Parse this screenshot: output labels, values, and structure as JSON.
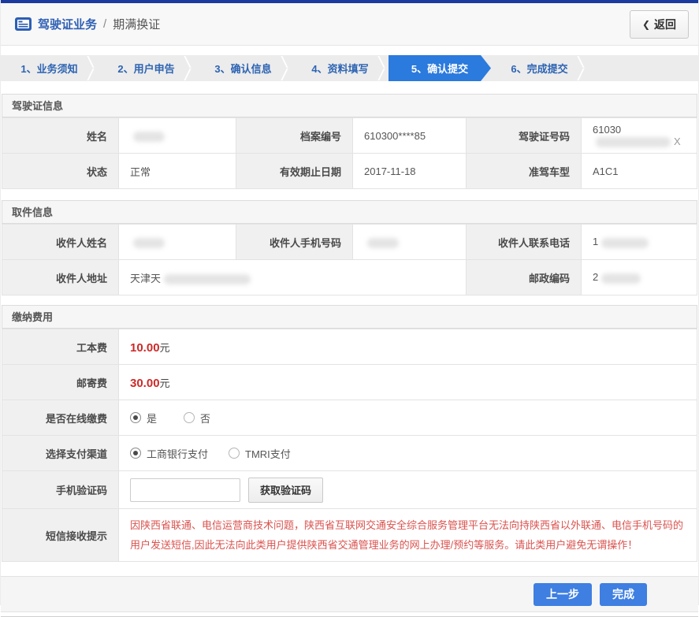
{
  "header": {
    "title_primary": "驾驶证业务",
    "separator": "/",
    "title_secondary": "期满换证",
    "back_chevron": "❮",
    "back_label": "返回"
  },
  "steps": [
    {
      "label": "1、业务须知",
      "active": false
    },
    {
      "label": "2、用户申告",
      "active": false
    },
    {
      "label": "3、确认信息",
      "active": false
    },
    {
      "label": "4、资料填写",
      "active": false
    },
    {
      "label": "5、确认提交",
      "active": true
    },
    {
      "label": "6、完成提交",
      "active": false
    }
  ],
  "license": {
    "title": "驾驶证信息",
    "name_label": "姓名",
    "name_value": "",
    "file_no_label": "档案编号",
    "file_no": "610300****85",
    "license_no_label": "驾驶证号码",
    "license_no_prefix": "61030",
    "license_no_suffix": "X",
    "status_label": "状态",
    "status": "正常",
    "expiry_label": "有效期止日期",
    "expiry": "2017-11-18",
    "class_label": "准驾车型",
    "class": "A1C1"
  },
  "pickup": {
    "title": "取件信息",
    "name_label": "收件人姓名",
    "mobile_label": "收件人手机号码",
    "phone_label": "收件人联系电话",
    "phone_prefix": "1",
    "address_label": "收件人地址",
    "address_prefix": "天津天",
    "postcode_label": "邮政编码",
    "postcode_prefix": "2"
  },
  "payment": {
    "title": "缴纳费用",
    "fee1_label": "工本费",
    "fee1_amount": "10.00",
    "fee1_unit": "元",
    "fee2_label": "邮寄费",
    "fee2_amount": "30.00",
    "fee2_unit": "元",
    "online_label": "是否在线缴费",
    "online_yes": "是",
    "online_no": "否",
    "channel_label": "选择支付渠道",
    "channel_icbc": "工商银行支付",
    "channel_tmri": "TMRI支付",
    "code_label": "手机验证码",
    "code_value": "",
    "get_code_button": "获取验证码",
    "sms_label": "短信接收提示",
    "sms_text": "因陕西省联通、电信运营商技术问题，陕西省互联网交通安全综合服务管理平台无法向持陕西省以外联通、电信手机号码的用户发送短信,因此无法向此类用户提供陕西省交通管理业务的网上办理/预约等服务。请此类用户避免无谓操作！"
  },
  "footer": {
    "prev_button": "上一步",
    "finish_button": "完成"
  },
  "colors": {
    "top_accent": "#1c3b9e",
    "active_step_blue": "#2b7add",
    "step_text_blue": "#2d64b3",
    "title_blue": "#2d5fb4",
    "fee_red": "#cc2a28",
    "note_red": "#d9534f",
    "button_blue": "#3e7fe1"
  }
}
